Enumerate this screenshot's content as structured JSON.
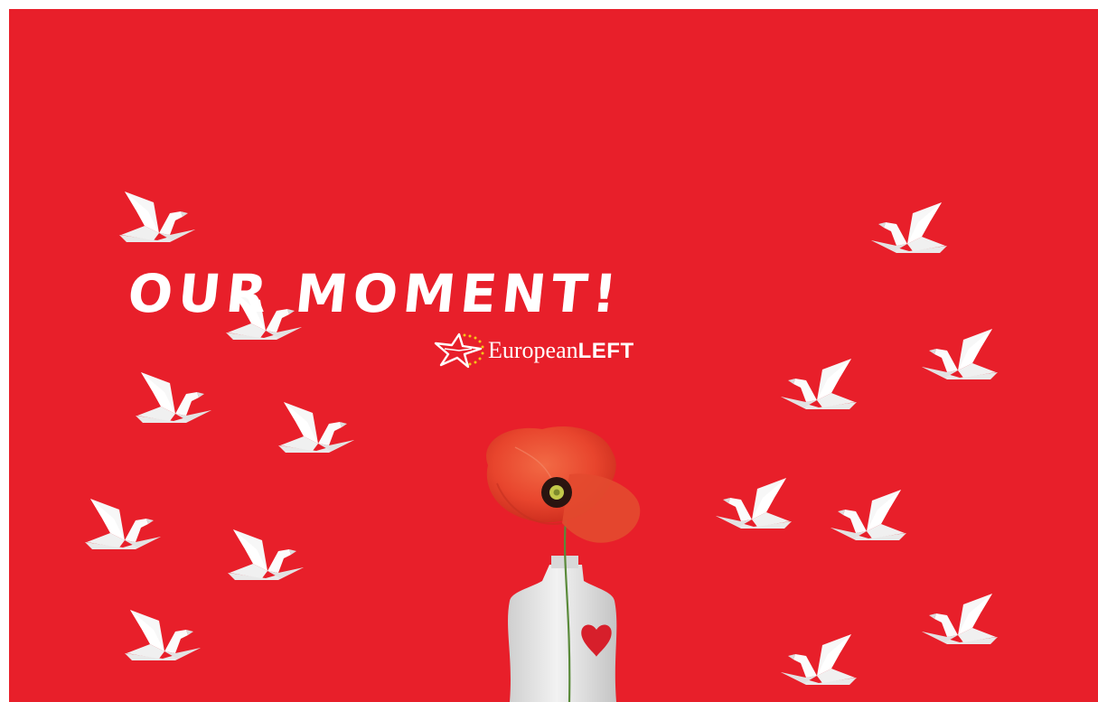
{
  "headline": "OUR MOMENT!",
  "logo": {
    "name_regular": "European",
    "name_bold": "LEFT"
  },
  "colors": {
    "background": "#e81f2a",
    "dove": "#ffffff",
    "poppy": "#e8452d",
    "logo_stars": "#f5c518"
  },
  "icons": {
    "dove": "origami-dove-icon",
    "logo": "star-logo-icon",
    "poppy": "poppy-flower-icon",
    "heart": "heart-icon"
  }
}
